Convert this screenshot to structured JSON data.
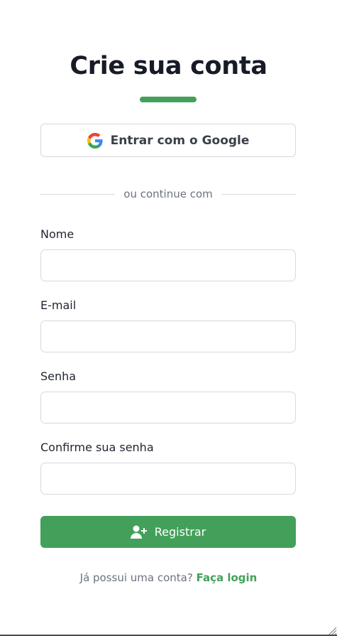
{
  "header": {
    "title": "Crie sua conta"
  },
  "google_button": {
    "label": "Entrar com o Google",
    "icon": "google-icon"
  },
  "divider": {
    "text": "ou continue com"
  },
  "form": {
    "fields": [
      {
        "label": "Nome",
        "value": "",
        "placeholder": ""
      },
      {
        "label": "E-mail",
        "value": "",
        "placeholder": ""
      },
      {
        "label": "Senha",
        "value": "",
        "placeholder": ""
      },
      {
        "label": "Confirme sua senha",
        "value": "",
        "placeholder": ""
      }
    ],
    "submit_label": "Registrar",
    "submit_icon": "user-plus-icon"
  },
  "footer": {
    "prompt": "Já possui uma conta?",
    "link_label": "Faça login"
  },
  "colors": {
    "accent": "#43a05a",
    "title": "#161b26",
    "muted": "#6c7280",
    "border": "#d6d9de"
  }
}
